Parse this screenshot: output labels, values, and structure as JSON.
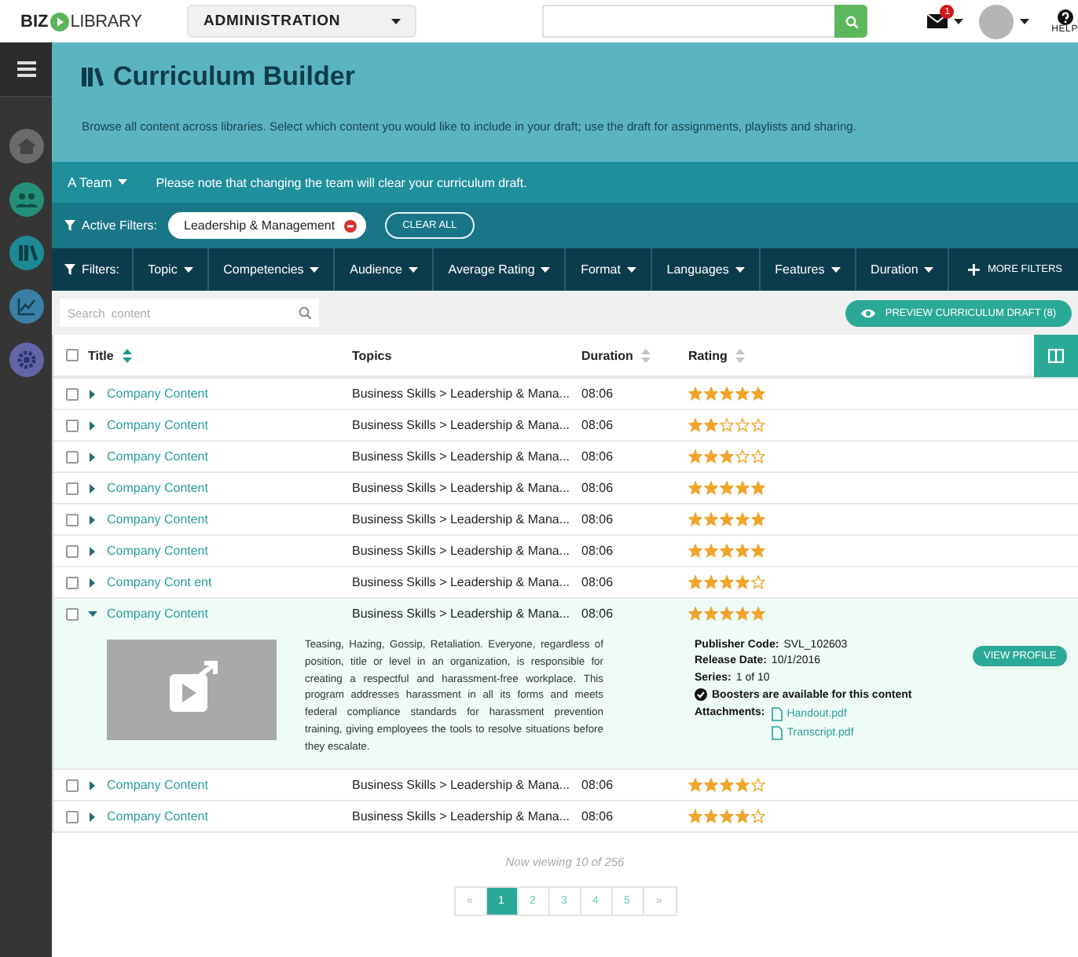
{
  "topbar": {
    "logo_left": "BIZ",
    "logo_right": "LIBRARY",
    "role_select": "ADMINISTRATION",
    "mail_badge": "1",
    "help": "HELP"
  },
  "header": {
    "title": "Curriculum Builder",
    "description": "Browse all content across libraries. Select which content you would like to include in your draft; use the draft for assignments, playlists and sharing."
  },
  "team": {
    "name": "A Team",
    "note": "Please note that changing the team will clear your curriculum draft."
  },
  "active_filters": {
    "label": "Active Filters:",
    "chips": [
      "Leadership & Management"
    ],
    "clear": "CLEAR ALL"
  },
  "filters": {
    "label": "Filters:",
    "items": [
      "Topic",
      "Competencies",
      "Audience",
      "Average Rating",
      "Format",
      "Languages",
      "Features",
      "Duration"
    ],
    "more": "MORE FILTERS"
  },
  "search": {
    "placeholder": "Search  content"
  },
  "preview_button": "PREVIEW CURRICULUM DRAFT (8)",
  "table": {
    "select_all": {
      "checked": false
    },
    "columns": [
      {
        "label": "Title",
        "sortable": true,
        "sorted": true
      },
      {
        "label": "Topics",
        "sortable": false
      },
      {
        "label": "Duration",
        "sortable": true,
        "sorted": false
      },
      {
        "label": "Rating",
        "sortable": true,
        "sorted": false
      }
    ],
    "rows": [
      {
        "title": "Company Content",
        "topic": "Business Skills > Leadership & Mana...",
        "duration": "08:06",
        "stars": 5,
        "checked": false,
        "expanded": false
      },
      {
        "title": "Company Content",
        "topic": "Business Skills > Leadership & Mana...",
        "duration": "08:06",
        "stars": 2,
        "checked": false,
        "expanded": false
      },
      {
        "title": "Company Content",
        "topic": "Business Skills > Leadership & Mana...",
        "duration": "08:06",
        "stars": 3,
        "checked": false,
        "expanded": false
      },
      {
        "title": "Company Content",
        "topic": "Business Skills > Leadership & Mana...",
        "duration": "08:06",
        "stars": 5,
        "checked": false,
        "expanded": false
      },
      {
        "title": "Company Content",
        "topic": "Business Skills > Leadership & Mana...",
        "duration": "08:06",
        "stars": 5,
        "checked": false,
        "expanded": false
      },
      {
        "title": "Company Content",
        "topic": "Business Skills > Leadership & Mana...",
        "duration": "08:06",
        "stars": 5,
        "checked": false,
        "expanded": false
      },
      {
        "title": "Company Cont ent",
        "topic": "Business Skills > Leadership & Mana...",
        "duration": "08:06",
        "stars": 4,
        "checked": false,
        "expanded": false
      },
      {
        "title": "Company Content",
        "topic": "Business Skills > Leadership & Mana...",
        "duration": "08:06",
        "stars": 5,
        "checked": false,
        "expanded": true,
        "details": {
          "description": "Teasing, Hazing, Gossip, Retaliation. Everyone, regardless of position, title or level in an organization, is responsible for creating a respectful and harassment-free workplace. This program addresses harassment in all its forms and meets federal compliance standards for harassment prevention training, giving employees the tools to resolve situations before they escalate.",
          "fields": [
            {
              "label": "Publisher Code:",
              "value": "SVL_102603"
            },
            {
              "label": "Release Date:",
              "value": "10/1/2016"
            },
            {
              "label": "Series:",
              "value": "1 of 10"
            }
          ],
          "booster": "Boosters are available for this content",
          "attachments_label": "Attachments:",
          "attachments": [
            "Handout.pdf",
            "Transcript.pdf"
          ],
          "button": "VIEW PROFILE"
        }
      },
      {
        "title": "Company Content",
        "topic": "Business Skills > Leadership & Mana...",
        "duration": "08:06",
        "stars": 4,
        "checked": false,
        "expanded": false
      },
      {
        "title": "Company Content",
        "topic": "Business Skills > Leadership & Mana...",
        "duration": "08:06",
        "stars": 4,
        "checked": false,
        "expanded": false
      }
    ]
  },
  "pager": {
    "status": "Now viewing 10 of 256",
    "prev": "«",
    "next": "»",
    "pages": [
      {
        "label": "1",
        "selected": true
      },
      {
        "label": "2",
        "selected": false
      },
      {
        "label": "3",
        "selected": false
      },
      {
        "label": "4",
        "selected": false
      },
      {
        "label": "5",
        "selected": false
      }
    ]
  }
}
